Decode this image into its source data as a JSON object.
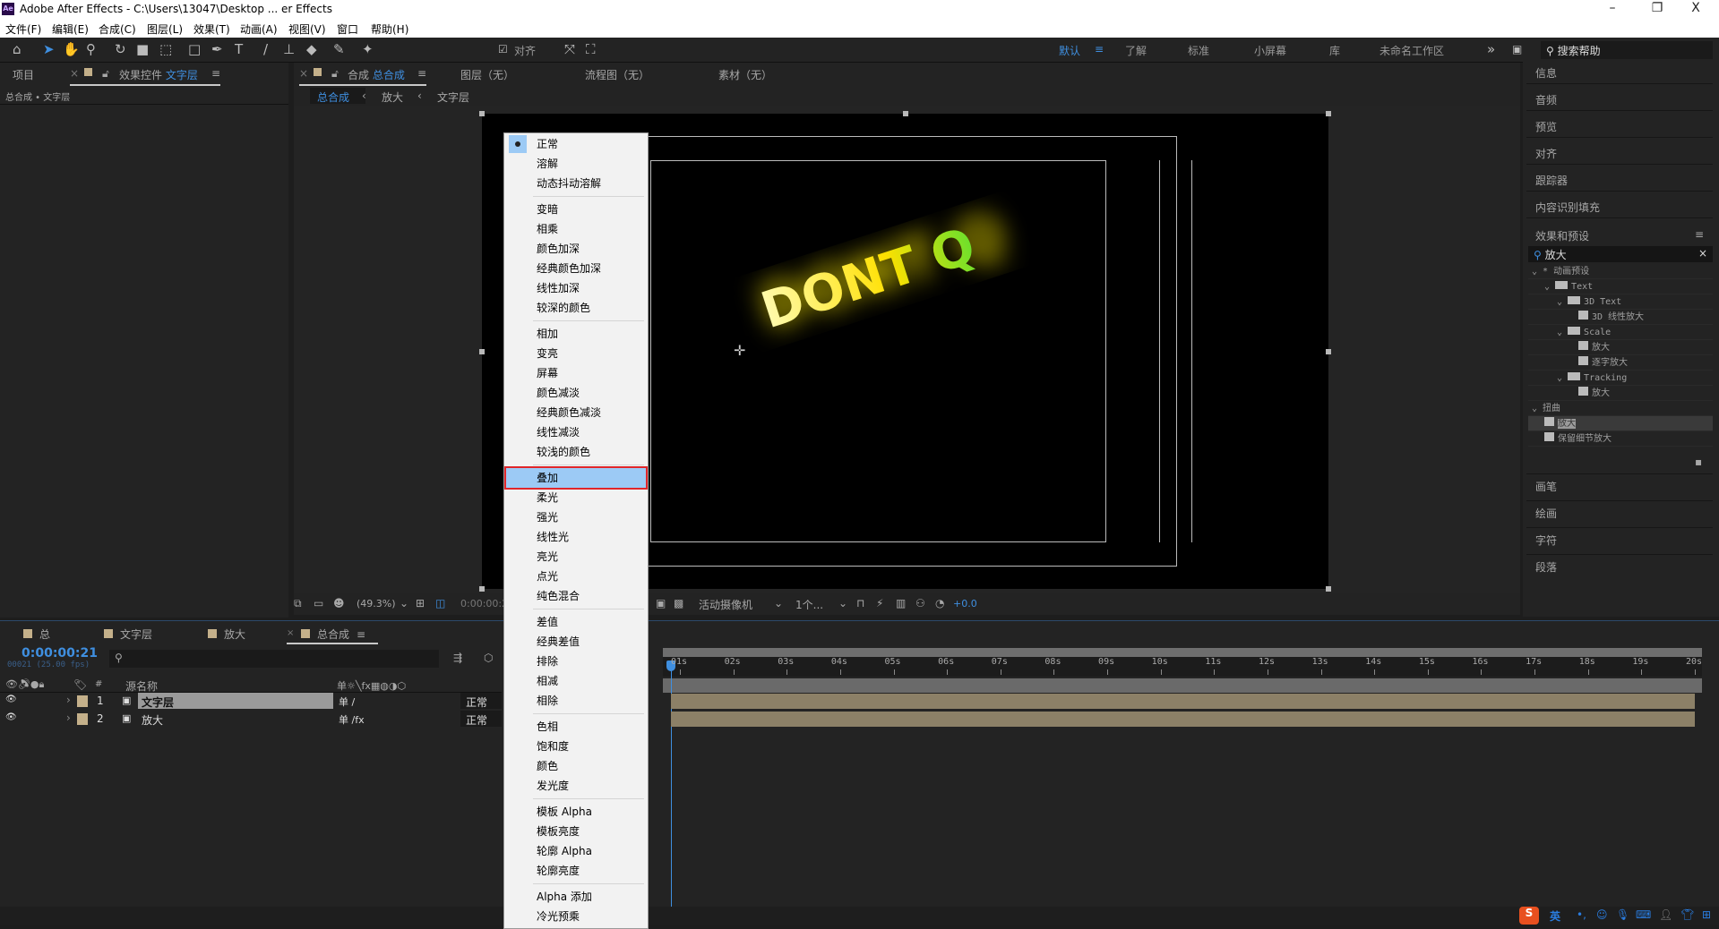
{
  "window": {
    "title": "Adobe After Effects - C:\\Users\\13047\\Desktop ... er Effects",
    "logo": "Ae",
    "minimize": "–",
    "maximize": "❐",
    "close": "X"
  },
  "menubar": [
    "文件(F)",
    "编辑(E)",
    "合成(C)",
    "图层(L)",
    "效果(T)",
    "动画(A)",
    "视图(V)",
    "窗口",
    "帮助(H)"
  ],
  "toolbar": {
    "snap_label": "对齐",
    "workspaces": [
      "默认",
      "了解",
      "标准",
      "小屏幕",
      "库",
      "未命名工作区"
    ],
    "active_workspace": "默认",
    "search_placeholder": "搜索帮助"
  },
  "left_panel": {
    "tab_project": "项目",
    "tab_effects_prefix": "效果控件",
    "tab_effects_layer": "文字层",
    "breadcrumb": "总合成 • 文字层"
  },
  "comp_panel": {
    "tab_prefix": "合成",
    "tab_name": "总合成",
    "other_tabs": [
      "图层（无）",
      "流程图（无）",
      "素材（无）"
    ],
    "breadcrumbs": [
      "总合成",
      "放大",
      "文字层"
    ],
    "preview_text": "DONT Q",
    "zoom": "(49.3%)",
    "time": "0:00:00:21",
    "camera": "活动摄像机",
    "views": "1个...",
    "exposure": "+0.0"
  },
  "blend_menu": {
    "groups": [
      [
        "正常",
        "溶解",
        "动态抖动溶解"
      ],
      [
        "变暗",
        "相乘",
        "颜色加深",
        "经典颜色加深",
        "线性加深",
        "较深的颜色"
      ],
      [
        "相加",
        "变亮",
        "屏幕",
        "颜色减淡",
        "经典颜色减淡",
        "线性减淡",
        "较浅的颜色"
      ],
      [
        "叠加",
        "柔光",
        "强光",
        "线性光",
        "亮光",
        "点光",
        "纯色混合"
      ],
      [
        "差值",
        "经典差值",
        "排除",
        "相减",
        "相除"
      ],
      [
        "色相",
        "饱和度",
        "颜色",
        "发光度"
      ],
      [
        "模板 Alpha",
        "模板亮度",
        "轮廓 Alpha",
        "轮廓亮度"
      ],
      [
        "Alpha 添加",
        "冷光预乘"
      ]
    ],
    "checked": "正常",
    "highlighted": "叠加",
    "highlight_color": "#9ccaf5",
    "outline_color": "#e0262a"
  },
  "right_panel": {
    "top_items": [
      "信息",
      "音频",
      "预览",
      "对齐",
      "跟踪器",
      "内容识别填充"
    ],
    "effects_title": "效果和预设",
    "search_value": "放大",
    "tree": [
      {
        "label": "* 动画预设",
        "level": 0,
        "type": "group"
      },
      {
        "label": "Text",
        "level": 1,
        "type": "folder"
      },
      {
        "label": "3D Text",
        "level": 2,
        "type": "folder"
      },
      {
        "label": "3D 线性放大",
        "level": 3,
        "type": "preset"
      },
      {
        "label": "Scale",
        "level": 2,
        "type": "folder"
      },
      {
        "label": "放大",
        "level": 3,
        "type": "preset"
      },
      {
        "label": "逐字放大",
        "level": 3,
        "type": "preset"
      },
      {
        "label": "Tracking",
        "level": 2,
        "type": "folder"
      },
      {
        "label": "放大",
        "level": 3,
        "type": "preset"
      },
      {
        "label": "扭曲",
        "level": 0,
        "type": "group"
      },
      {
        "label": "放大",
        "level": 1,
        "type": "effect8",
        "selected": true
      },
      {
        "label": "保留细节放大",
        "level": 1,
        "type": "effect32"
      }
    ],
    "bottom_items": [
      "画笔",
      "绘画",
      "字符",
      "段落"
    ]
  },
  "timeline": {
    "tabs": [
      "总",
      "文字层",
      "放大",
      "总合成"
    ],
    "active_tab": "总合成",
    "timecode": "0:00:00:21",
    "frame_info": "00021 (25.00 fps)",
    "col_source": "源名称",
    "col_num": "#",
    "ticks": [
      "01s",
      "02s",
      "03s",
      "04s",
      "05s",
      "06s",
      "07s",
      "08s",
      "09s",
      "10s",
      "11s",
      "12s",
      "13s",
      "14s",
      "15s",
      "16s",
      "17s",
      "18s",
      "19s",
      "20s"
    ],
    "layers": [
      {
        "num": "1",
        "name": "文字层",
        "mode": "正常",
        "selected": true
      },
      {
        "num": "2",
        "name": "放大",
        "mode": "正常",
        "selected": false
      }
    ],
    "label_color": "#c4b08a",
    "track_color": "#8c8067"
  },
  "taskbar": {
    "ime_lang": "英"
  }
}
